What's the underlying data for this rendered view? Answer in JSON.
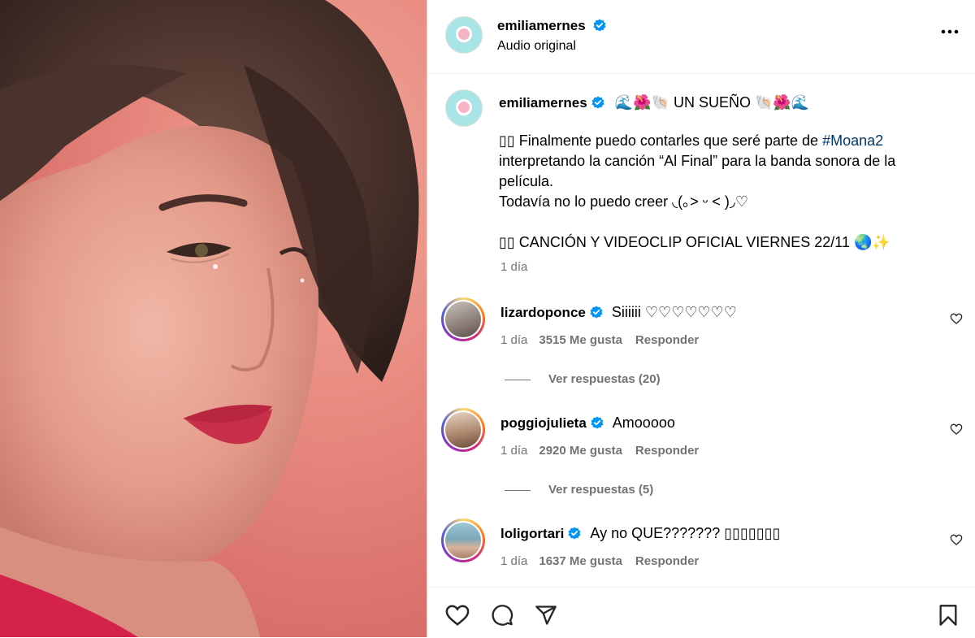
{
  "post": {
    "author": "emiliamernes",
    "audio_label": "Audio original",
    "caption_title_emoji_left": "🌊🌺🐚",
    "caption_title": "UN SUEÑO",
    "caption_title_emoji_right": "🐚🌺🌊",
    "caption_line1_prefix": "▯▯ Finalmente puedo contarles que seré parte de",
    "caption_hashtag": "#Moana2",
    "caption_line2": "interpretando la canción “Al Final” para la banda sonora de la",
    "caption_line3": "película.",
    "caption_line4": "Todavía no lo puedo creer ◟(｡> ᵕ < )◞♡",
    "caption_line5": "▯▯ CANCIÓN Y VIDEOCLIP OFICIAL VIERNES 22/11",
    "caption_line5_emoji": "🌏✨",
    "time": "1 día"
  },
  "comments": [
    {
      "user": "lizardoponce",
      "text": "Siiiiii ♡♡♡♡♡♡♡",
      "time": "1 día",
      "likes": "3515 Me gusta",
      "reply": "Responder",
      "view_replies": "Ver respuestas (20)"
    },
    {
      "user": "poggiojulieta",
      "text": "Amooooo",
      "time": "1 día",
      "likes": "2920 Me gusta",
      "reply": "Responder",
      "view_replies": "Ver respuestas (5)"
    },
    {
      "user": "loligortari",
      "text": "Ay no QUE??????? ▯▯▯▯▯▯▯",
      "time": "1 día",
      "likes": "1637 Me gusta",
      "reply": "Responder"
    }
  ],
  "colors": {
    "verified": "#0095f6",
    "hashtag": "#00376b",
    "muted": "#737373"
  }
}
